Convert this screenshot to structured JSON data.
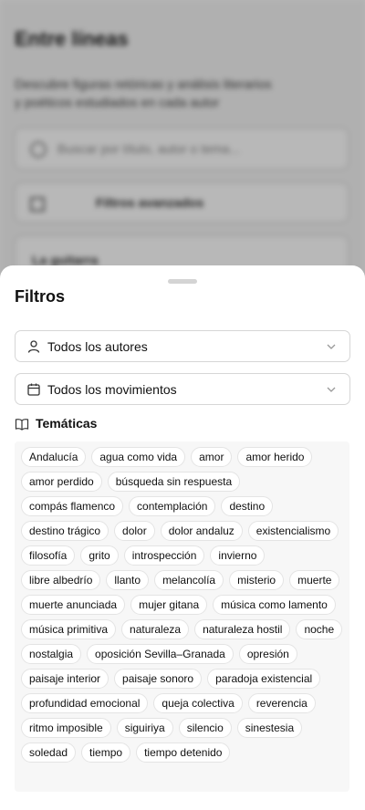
{
  "background": {
    "title": "Entre líneas",
    "subtitle": "Descubre figuras retóricas y análisis literarios y poéticos estudiados en cada autor",
    "search_placeholder": "Buscar por título, autor o tema...",
    "filters_label": "Filtros avanzados",
    "card_label": "La guitarra"
  },
  "sheet": {
    "title": "Filtros",
    "authors_select": {
      "value": "Todos los autores",
      "icon": "user-icon"
    },
    "movements_select": {
      "value": "Todos los movimientos",
      "icon": "calendar-icon"
    },
    "themes_heading": {
      "label": "Temáticas",
      "icon": "book-open-icon"
    },
    "tags": [
      "Andalucía",
      "agua como vida",
      "amor",
      "amor herido",
      "amor perdido",
      "búsqueda sin respuesta",
      "compás flamenco",
      "contemplación",
      "destino",
      "destino trágico",
      "dolor",
      "dolor andaluz",
      "existencialismo",
      "filosofía",
      "grito",
      "introspección",
      "invierno",
      "libre albedrío",
      "llanto",
      "melancolía",
      "misterio",
      "muerte",
      "muerte anunciada",
      "mujer gitana",
      "música como lamento",
      "música primitiva",
      "naturaleza",
      "naturaleza hostil",
      "noche",
      "nostalgia",
      "oposición Sevilla–Granada",
      "opresión",
      "paisaje interior",
      "paisaje sonoro",
      "paradoja existencial",
      "profundidad emocional",
      "queja colectiva",
      "reverencia",
      "ritmo imposible",
      "siguiriya",
      "silencio",
      "sinestesia",
      "soledad",
      "tiempo",
      "tiempo detenido"
    ]
  },
  "colors": {
    "scrim": "#000000",
    "sheet": "#ffffff",
    "tag_border": "#e4e4e4",
    "tags_bg": "#f7f7f7"
  }
}
